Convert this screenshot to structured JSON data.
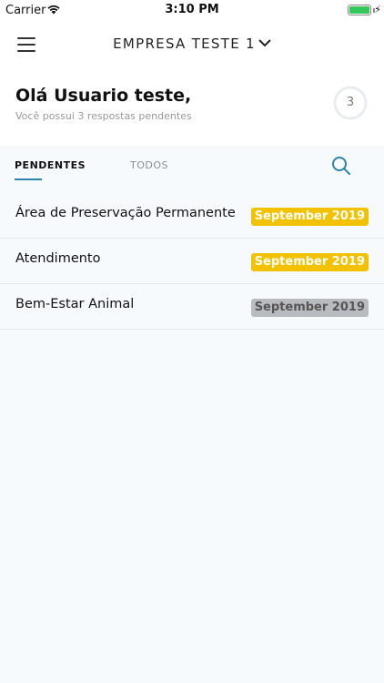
{
  "status_bar": {
    "carrier": "Carrier",
    "time": "3:10 PM"
  },
  "header": {
    "company_name": "EMPRESA TESTE 1"
  },
  "greeting": {
    "title": "Olá Usuario teste,",
    "subtitle": "Você possui 3 respostas pendentes",
    "pending_count": "3"
  },
  "tabs": [
    {
      "label": "PENDENTES",
      "active": true
    },
    {
      "label": "TODOS",
      "active": false
    }
  ],
  "items": [
    {
      "name": "Área de Preservação Permanente",
      "date": "September 2019",
      "badge_color": "#f2c200"
    },
    {
      "name": "Atendimento",
      "date": "September 2019",
      "badge_color": "#f2c200"
    },
    {
      "name": "Bem-Estar Animal",
      "date": "September 2019",
      "badge_color": "#b8bcc0"
    }
  ],
  "colors": {
    "accent": "#2d83a8",
    "badge_yellow": "#f2c200",
    "badge_gray": "#b8bcc0",
    "battery": "#34c759"
  },
  "icons": {
    "menu": "hamburger-menu-icon",
    "dropdown": "chevron-down-icon",
    "search": "search-icon"
  }
}
